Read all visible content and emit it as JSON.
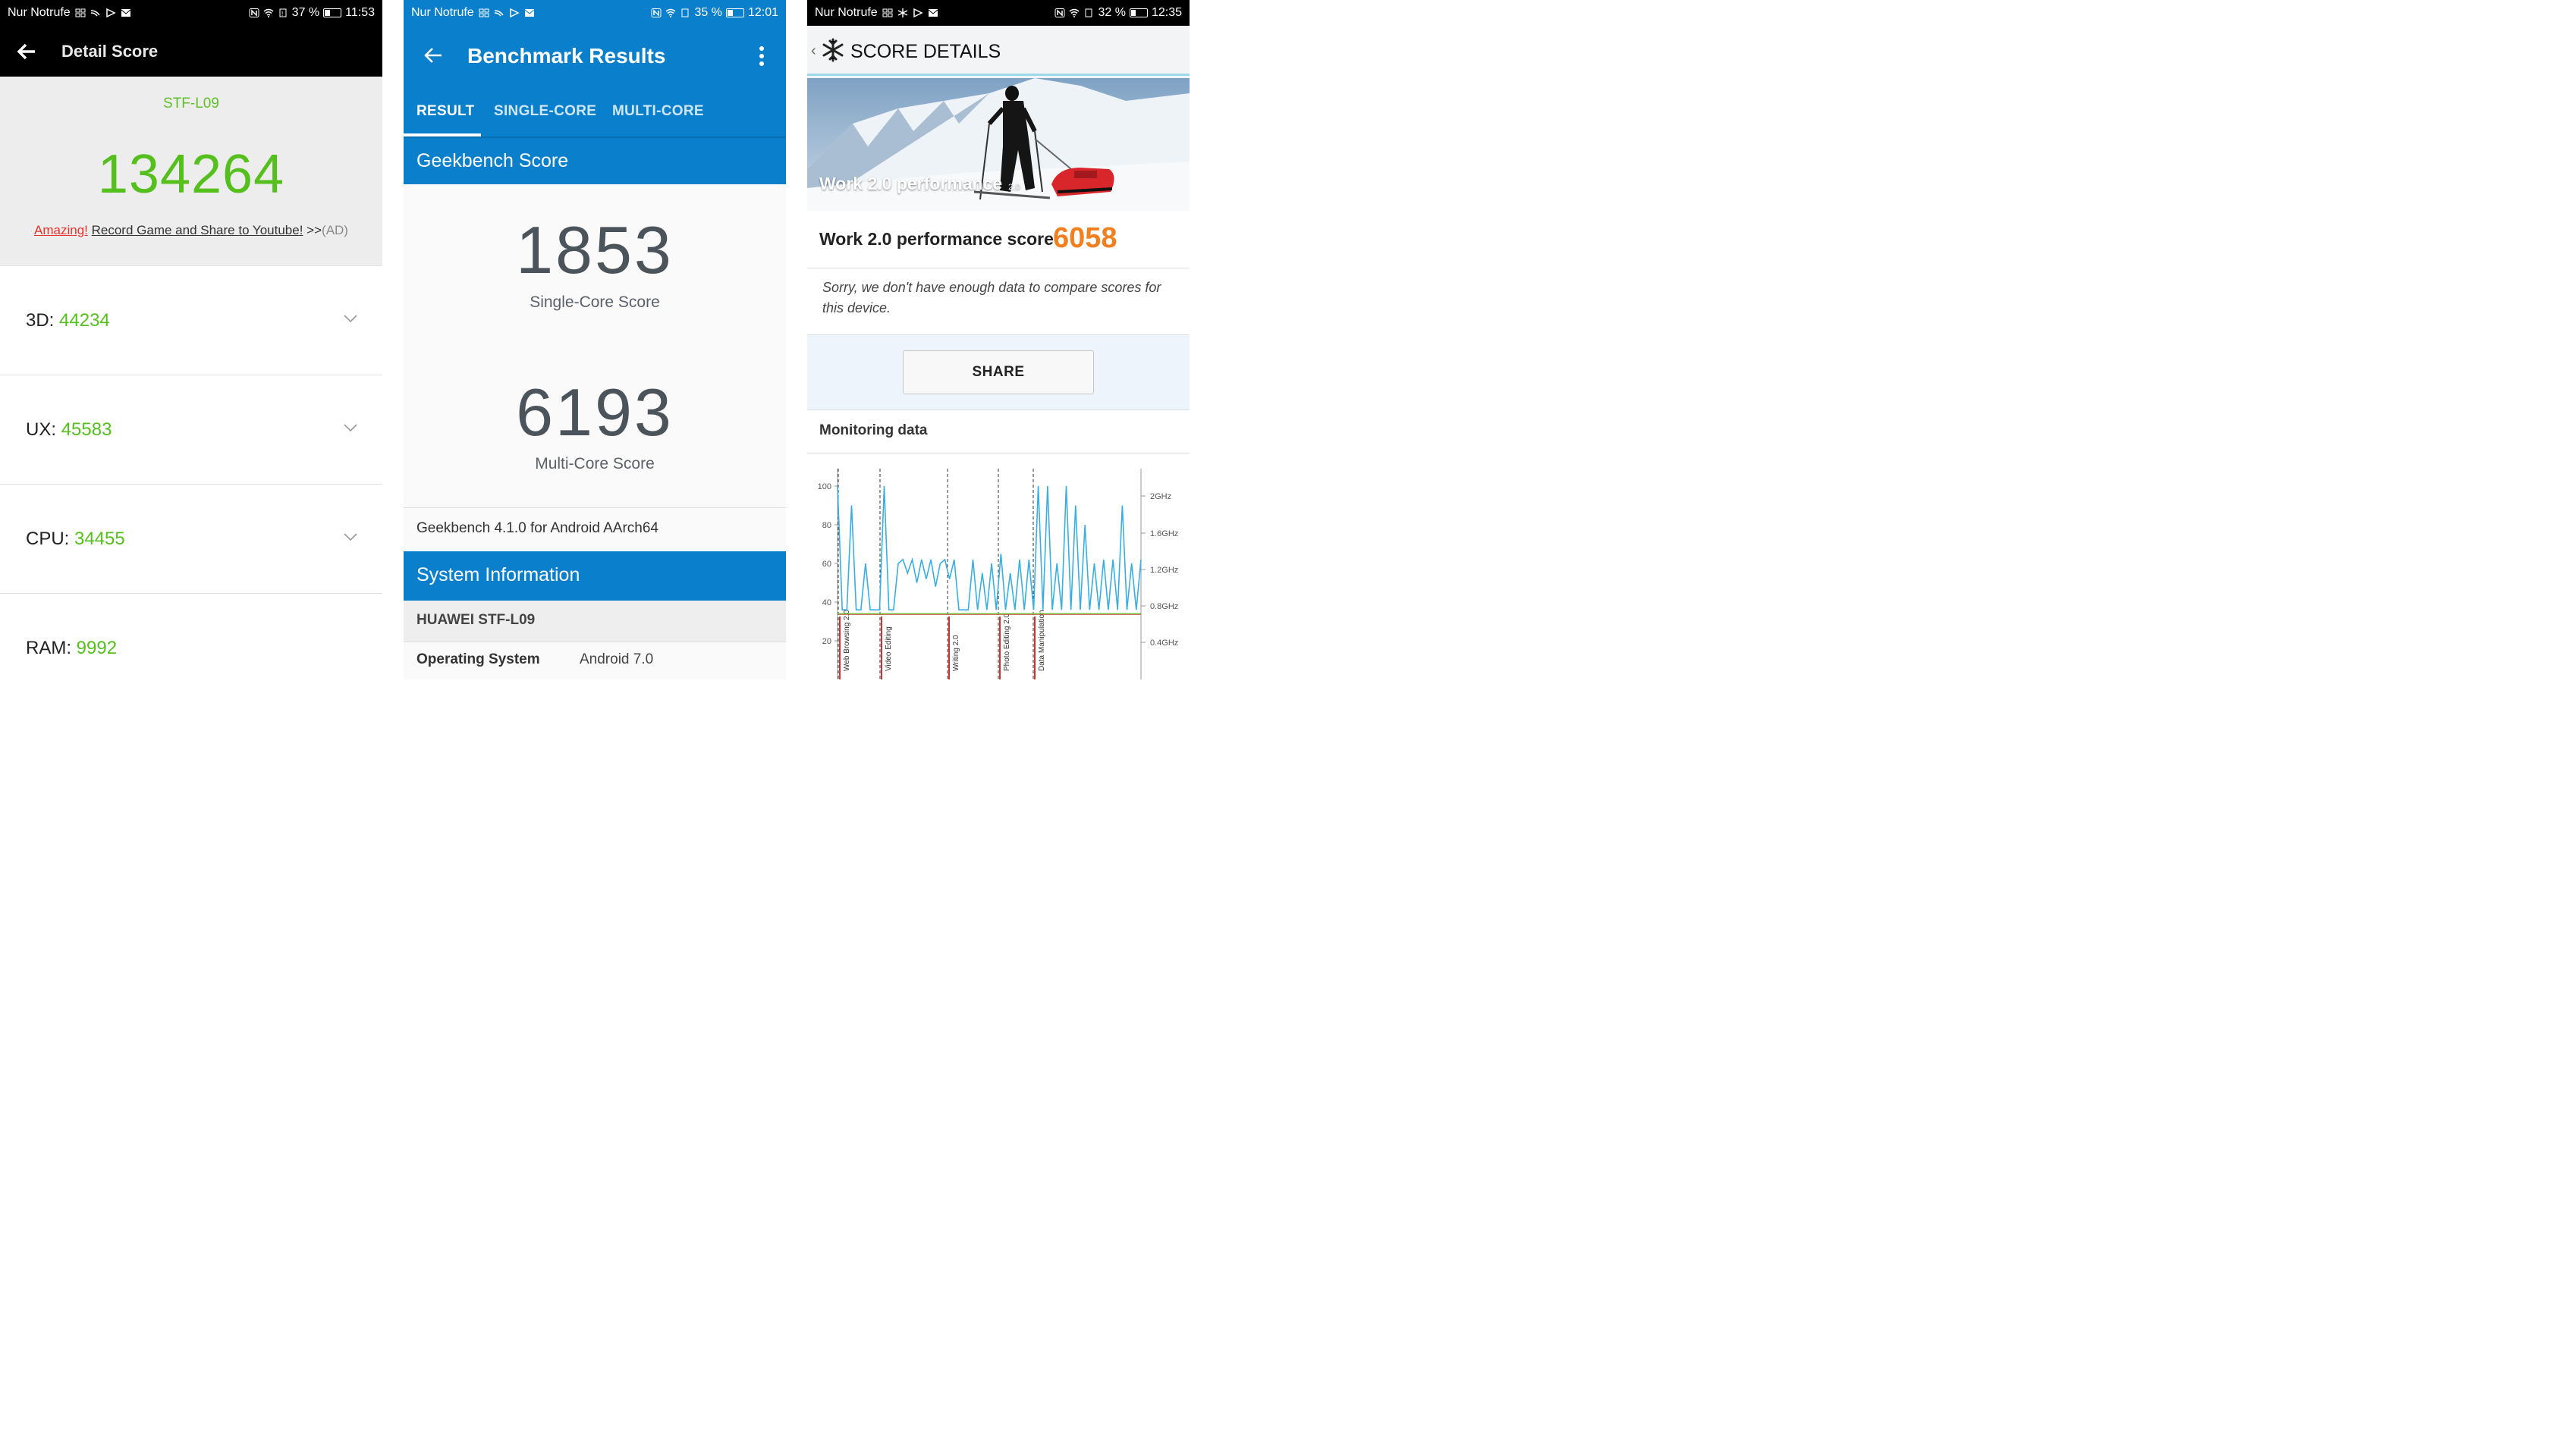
{
  "antutu": {
    "status": {
      "carrier": "Nur Notrufe",
      "battery": "37 %",
      "battery_level": 0.37,
      "time": "11:53"
    },
    "header": {
      "title": "Detail Score"
    },
    "model": "STF-L09",
    "total_score": "134264",
    "ad": {
      "amazing": "Amazing!",
      "text": "Record Game and Share to Youtube!",
      "suffix": " >>",
      "tag": "(AD)"
    },
    "rows": [
      {
        "label": "3D:",
        "value": "44234"
      },
      {
        "label": "UX:",
        "value": "45583"
      },
      {
        "label": "CPU:",
        "value": "34455"
      },
      {
        "label": "RAM:",
        "value": "9992"
      }
    ],
    "colors": {
      "score_green": "#55bf1d",
      "ad_red": "#e8322c",
      "header_bg": "#000000"
    }
  },
  "geekbench": {
    "status": {
      "carrier": "Nur Notrufe",
      "battery": "35 %",
      "battery_level": 0.35,
      "time": "12:01"
    },
    "appbar": {
      "title": "Benchmark Results"
    },
    "tabs": [
      {
        "label": "RESULT",
        "active": true
      },
      {
        "label": "SINGLE-CORE",
        "active": false
      },
      {
        "label": "MULTI-CORE",
        "active": false
      }
    ],
    "score_section": "Geekbench Score",
    "single_core": {
      "value": "1853",
      "label": "Single-Core Score"
    },
    "multi_core": {
      "value": "6193",
      "label": "Multi-Core Score"
    },
    "version": "Geekbench 4.1.0 for Android AArch64",
    "system_section": "System Information",
    "device": "HUAWEI STF-L09",
    "os": {
      "key": "Operating System",
      "value": "Android 7.0"
    },
    "colors": {
      "brand_blue": "#0a7fcb",
      "score_gray": "#4b535b"
    }
  },
  "pcmark": {
    "status": {
      "carrier": "Nur Notrufe",
      "battery": "32 %",
      "battery_level": 0.32,
      "time": "12:35"
    },
    "header": {
      "title": "SCORE DETAILS",
      "back_glyph": "‹"
    },
    "banner": {
      "title": "Work 2.0 performance",
      "version": "2.0"
    },
    "score": {
      "label": "Work 2.0 performance score",
      "value": "6058"
    },
    "sorry": "Sorry, we don't have enough data to compare scores for this device.",
    "share_label": "SHARE",
    "monitoring_title": "Monitoring data",
    "colors": {
      "score_orange": "#f28020",
      "line_blue": "#3aaee0",
      "temp_green": "#7ac143",
      "marker_red": "#d0312d"
    }
  },
  "chart_data": {
    "type": "line",
    "title": "",
    "ylabel_left_ticks": [
      "100",
      "80",
      "60",
      "40",
      "20"
    ],
    "ylabel_right_ticks": [
      "2GHz",
      "1.6GHz",
      "1.2GHz",
      "0.8GHz",
      "0.4GHz"
    ],
    "ylim": [
      0,
      100
    ],
    "segments": [
      "Web Browsing 2.0",
      "Video Editing",
      "Writing 2.0",
      "Photo Editing 2.0",
      "Data Manipulation"
    ],
    "series": [
      {
        "name": "",
        "color": "#3aaee0",
        "values": [
          100,
          36,
          36,
          90,
          36,
          36,
          60,
          36,
          36,
          36,
          100,
          36,
          36,
          60,
          62,
          55,
          62,
          50,
          62,
          52,
          62,
          48,
          60,
          62,
          52,
          62,
          36,
          36,
          36,
          62,
          36,
          55,
          36,
          60,
          36,
          65,
          36,
          55,
          36,
          62,
          36,
          62,
          36,
          100,
          36,
          100,
          36,
          60,
          36,
          100,
          36,
          90,
          36,
          80,
          36,
          60,
          36,
          62,
          36,
          62,
          36,
          90,
          36,
          60,
          36,
          62
        ]
      },
      {
        "name": "",
        "color": "#7ac143",
        "values": [
          34,
          34,
          34,
          34,
          34,
          34,
          34,
          34,
          34,
          34,
          34,
          34,
          34,
          34,
          34,
          34,
          34,
          34,
          34,
          34,
          34,
          34,
          34,
          34,
          34,
          34,
          34,
          34,
          34,
          34,
          34,
          34,
          34,
          34,
          34,
          34,
          34,
          34,
          34,
          34,
          34,
          34,
          34,
          34,
          34,
          34,
          34,
          34,
          34,
          34,
          34,
          34,
          34,
          34,
          34,
          34,
          34,
          34,
          34,
          34,
          34,
          34,
          34,
          34,
          34,
          34
        ]
      }
    ],
    "grid": true,
    "legend": "none"
  }
}
